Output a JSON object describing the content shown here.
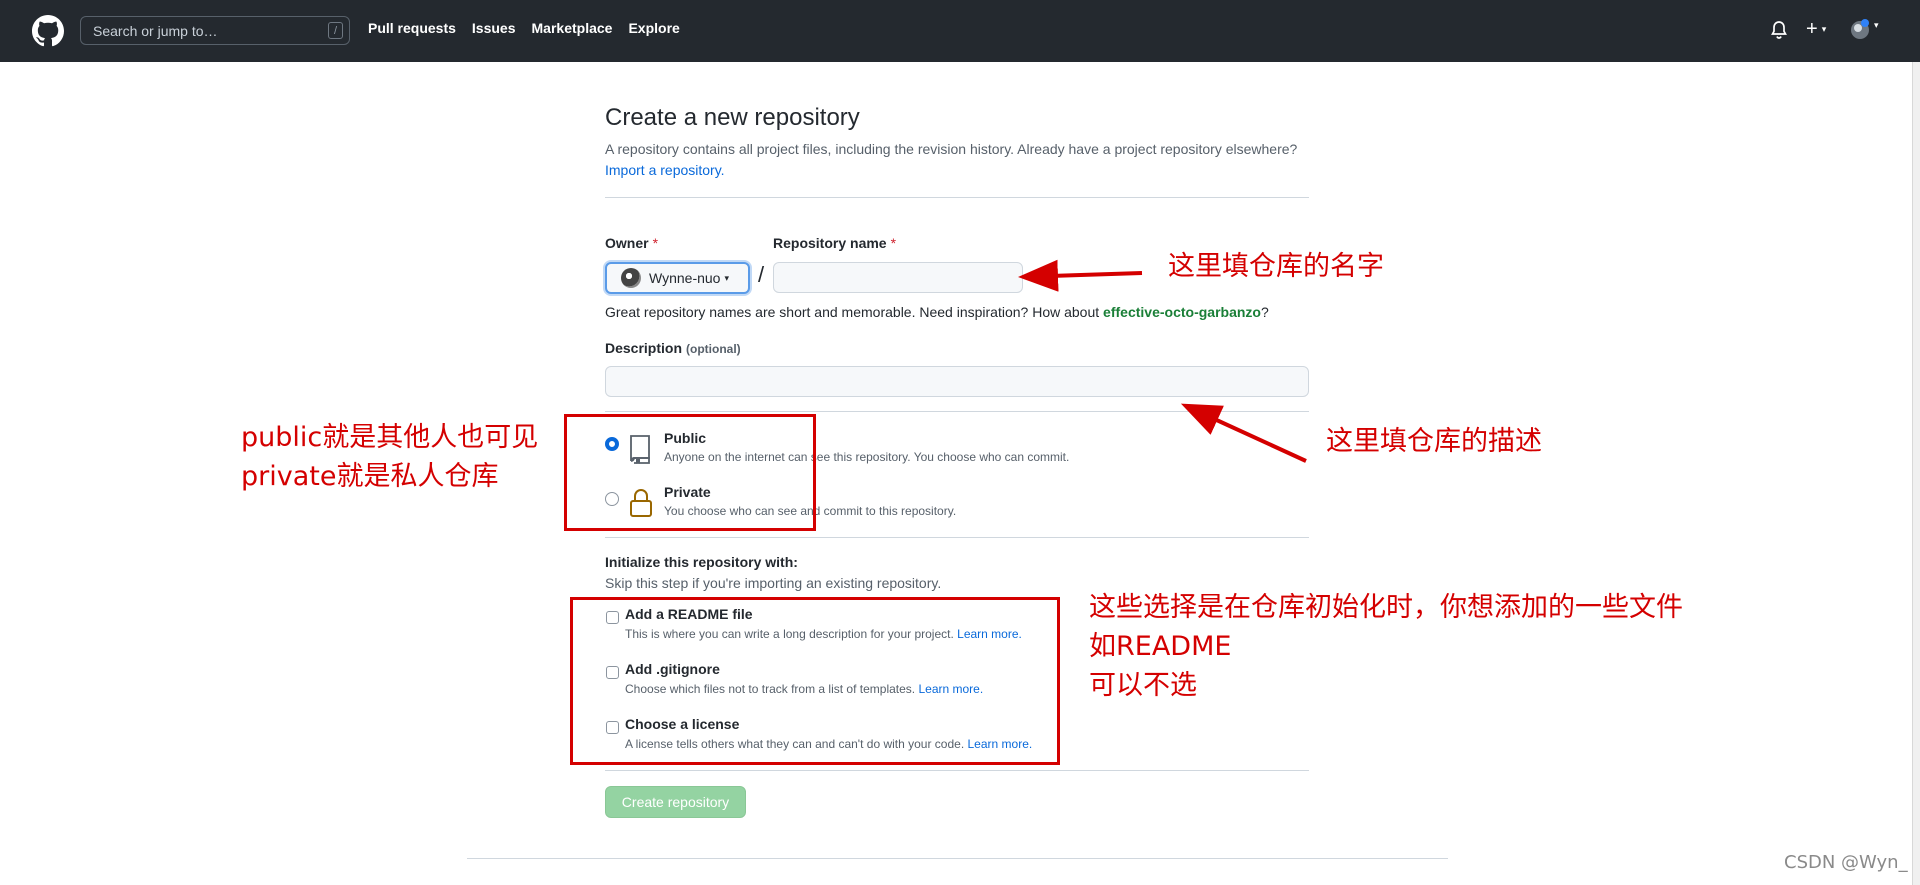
{
  "header": {
    "search_placeholder": "Search or jump to…",
    "search_shortcut": "/",
    "nav": [
      "Pull requests",
      "Issues",
      "Marketplace",
      "Explore"
    ],
    "plus_label": "+",
    "caret": "▾"
  },
  "page": {
    "title": "Create a new repository",
    "subtitle": "A repository contains all project files, including the revision history. Already have a project repository elsewhere?",
    "import_link": "Import a repository.",
    "owner_label": "Owner",
    "required_mark": "*",
    "owner_value": "Wynne-nuo",
    "separator": "/",
    "repo_name_label": "Repository name",
    "hint_prefix": "Great repository names are short and memorable. Need inspiration? How about ",
    "hint_suggestion": "effective-octo-garbanzo",
    "hint_suffix": "?",
    "description_label": "Description",
    "description_optional": "(optional)",
    "visibility": {
      "public_title": "Public",
      "public_desc": "Anyone on the internet can see this repository. You choose who can commit.",
      "private_title": "Private",
      "private_desc": "You choose who can see and commit to this repository.",
      "selected": "Public"
    },
    "init_title": "Initialize this repository with:",
    "init_subtitle": "Skip this step if you're importing an existing repository.",
    "options": [
      {
        "title": "Add a README file",
        "desc": "This is where you can write a long description for your project. ",
        "link": "Learn more."
      },
      {
        "title": "Add .gitignore",
        "desc": "Choose which files not to track from a list of templates. ",
        "link": "Learn more."
      },
      {
        "title": "Choose a license",
        "desc": "A license tells others what they can and can't do with your code. ",
        "link": "Learn more."
      }
    ],
    "create_button": "Create repository"
  },
  "annotations": {
    "repo_name_note": "这里填仓库的名字",
    "description_note": "这里填仓库的描述",
    "visibility_note": "public就是其他人也可见\nprivate就是私人仓库",
    "init_note": "这些选择是在仓库初始化时，你想添加的一些文件\n如README\n可以不选",
    "accent_color": "#d40000"
  },
  "watermark": "CSDN @Wyn_"
}
